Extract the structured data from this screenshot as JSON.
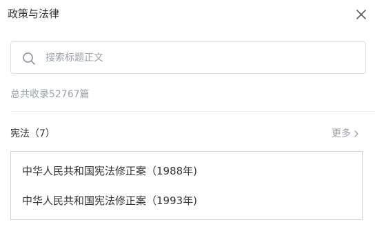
{
  "panel": {
    "title": "政策与法律"
  },
  "search": {
    "placeholder": "搜索标题正文",
    "value": ""
  },
  "summary": {
    "total_text": "总共收录52767篇"
  },
  "section": {
    "label": "宪法（7）",
    "more_label": "更多"
  },
  "results": [
    {
      "title": "中华人民共和国宪法修正案（1988年)"
    },
    {
      "title": "中华人民共和国宪法修正案（1993年)"
    }
  ],
  "icons": {
    "close": "close-icon",
    "search": "search-icon",
    "more": "chevron-right-icon"
  },
  "colors": {
    "text": "#333333",
    "muted": "#9aa1ab",
    "border": "#dcdfe4"
  }
}
